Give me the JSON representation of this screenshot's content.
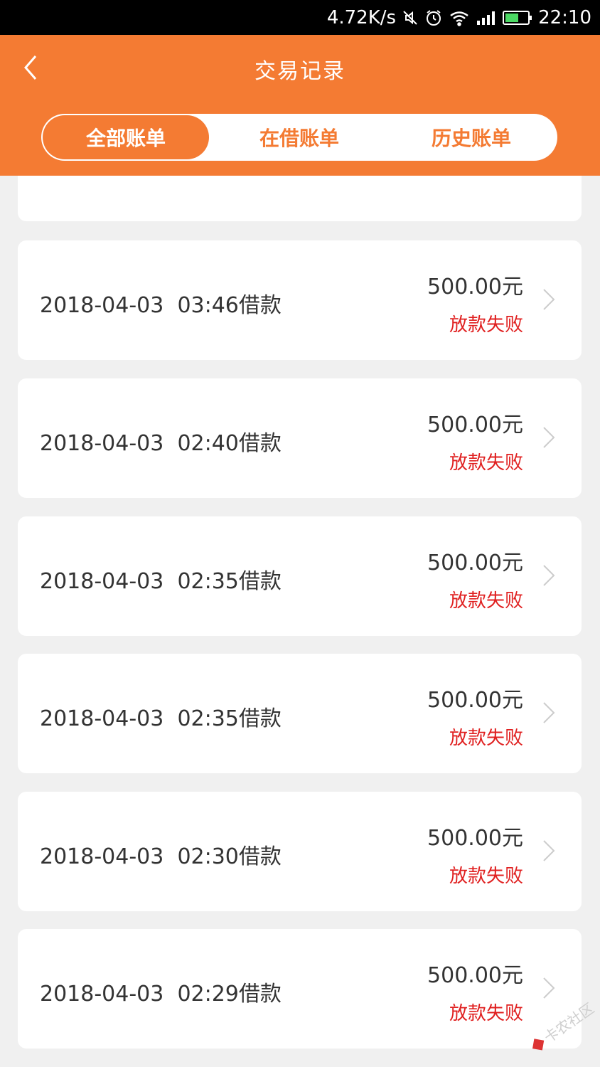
{
  "status_bar": {
    "net_speed": "4.72K/s",
    "time": "22:10",
    "icons": [
      "mute-icon",
      "alarm-icon",
      "wifi-icon",
      "signal-icon",
      "battery-icon"
    ]
  },
  "header": {
    "title": "交易记录",
    "back_icon": "chevron-left-icon"
  },
  "tabs": [
    {
      "label": "全部账单",
      "active": true
    },
    {
      "label": "在借账单",
      "active": false
    },
    {
      "label": "历史账单",
      "active": false
    }
  ],
  "records": [
    {
      "date": "2018-04-03",
      "time": "03:46",
      "type": "借款",
      "amount": "500.00元",
      "status": "放款失败"
    },
    {
      "date": "2018-04-03",
      "time": "02:40",
      "type": "借款",
      "amount": "500.00元",
      "status": "放款失败"
    },
    {
      "date": "2018-04-03",
      "time": "02:35",
      "type": "借款",
      "amount": "500.00元",
      "status": "放款失败"
    },
    {
      "date": "2018-04-03",
      "time": "02:35",
      "type": "借款",
      "amount": "500.00元",
      "status": "放款失败"
    },
    {
      "date": "2018-04-03",
      "time": "02:30",
      "type": "借款",
      "amount": "500.00元",
      "status": "放款失败"
    },
    {
      "date": "2018-04-03",
      "time": "02:29",
      "type": "借款",
      "amount": "500.00元",
      "status": "放款失败"
    }
  ],
  "watermark": {
    "text": "卡农社区"
  },
  "colors": {
    "primary": "#f47b33",
    "failure": "#e02020",
    "background": "#f0f0f0"
  }
}
